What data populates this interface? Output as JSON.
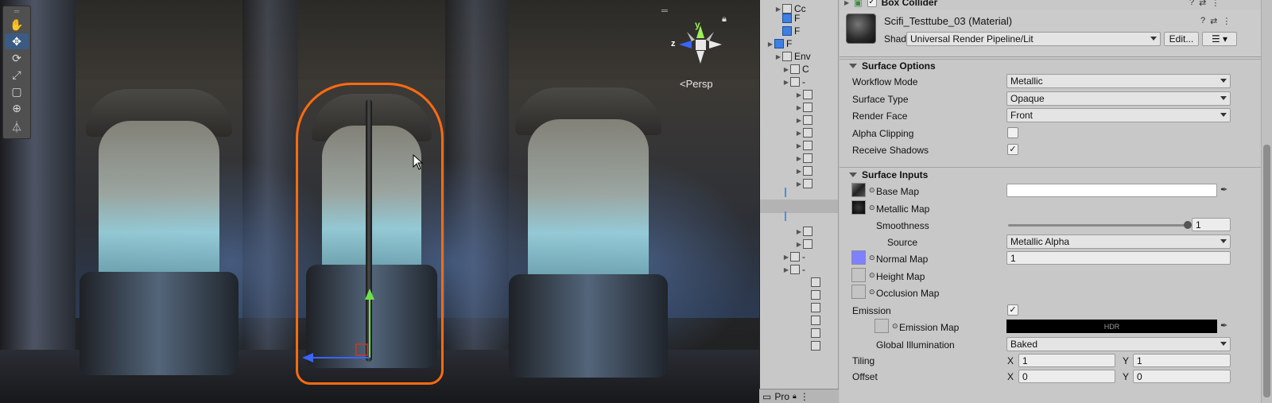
{
  "scene": {
    "view_mode": "Persp",
    "gizmo_axes": {
      "y": "y",
      "z": "z"
    },
    "tools": [
      {
        "name": "hand-tool",
        "glyph": "✋",
        "active": false
      },
      {
        "name": "move-tool",
        "glyph": "✥",
        "active": true
      },
      {
        "name": "rotate-tool",
        "glyph": "⟳",
        "active": false
      },
      {
        "name": "scale-tool",
        "glyph": "⤢",
        "active": false
      },
      {
        "name": "rect-tool",
        "glyph": "▢",
        "active": false
      },
      {
        "name": "transform-tool",
        "glyph": "⊕",
        "active": false
      },
      {
        "name": "custom-tool",
        "glyph": "⏃",
        "active": false
      }
    ],
    "colors": {
      "selection_outline": "#ff6a10",
      "tool_active": "#3a5b83"
    }
  },
  "hierarchy": {
    "rows": [
      "Cc",
      "F",
      "F",
      "F",
      "Env",
      "C",
      "-",
      "",
      "",
      "",
      "",
      "",
      "",
      "",
      "",
      "",
      "",
      "-",
      "-",
      "",
      "",
      "",
      "",
      "",
      ""
    ],
    "project_tab": "Pro"
  },
  "inspector": {
    "component_title": "Box Collider",
    "material_name": "Scifi_Testtube_03 (Material)",
    "shader_label": "Shader",
    "shader_value": "Universal Render Pipeline/Lit",
    "edit_button": "Edit...",
    "surface_options": {
      "title": "Surface Options",
      "workflow_mode": {
        "label": "Workflow Mode",
        "value": "Metallic"
      },
      "surface_type": {
        "label": "Surface Type",
        "value": "Opaque"
      },
      "render_face": {
        "label": "Render Face",
        "value": "Front"
      },
      "alpha_clipping": {
        "label": "Alpha Clipping",
        "checked": false
      },
      "receive_shadows": {
        "label": "Receive Shadows",
        "checked": true,
        "glyph": "✓"
      }
    },
    "surface_inputs": {
      "title": "Surface Inputs",
      "base_map": {
        "label": "Base Map"
      },
      "metallic_map": {
        "label": "Metallic Map"
      },
      "smoothness": {
        "label": "Smoothness",
        "value": "1",
        "fraction": 1.0
      },
      "source": {
        "label": "Source",
        "value": "Metallic Alpha"
      },
      "normal_map": {
        "label": "Normal Map",
        "value": "1",
        "color": "#7f80ff"
      },
      "height_map": {
        "label": "Height Map"
      },
      "occlusion_map": {
        "label": "Occlusion Map"
      },
      "emission": {
        "label": "Emission",
        "checked": true,
        "glyph": "✓"
      },
      "emission_map": {
        "label": "Emission Map",
        "hdr_label": "HDR"
      },
      "global_illumination": {
        "label": "Global Illumination",
        "value": "Baked"
      },
      "tiling": {
        "label": "Tiling",
        "x_label": "X",
        "x": "1",
        "y_label": "Y",
        "y": "1"
      },
      "offset": {
        "label": "Offset",
        "x_label": "X",
        "x": "0",
        "y_label": "Y",
        "y": "0"
      }
    }
  }
}
